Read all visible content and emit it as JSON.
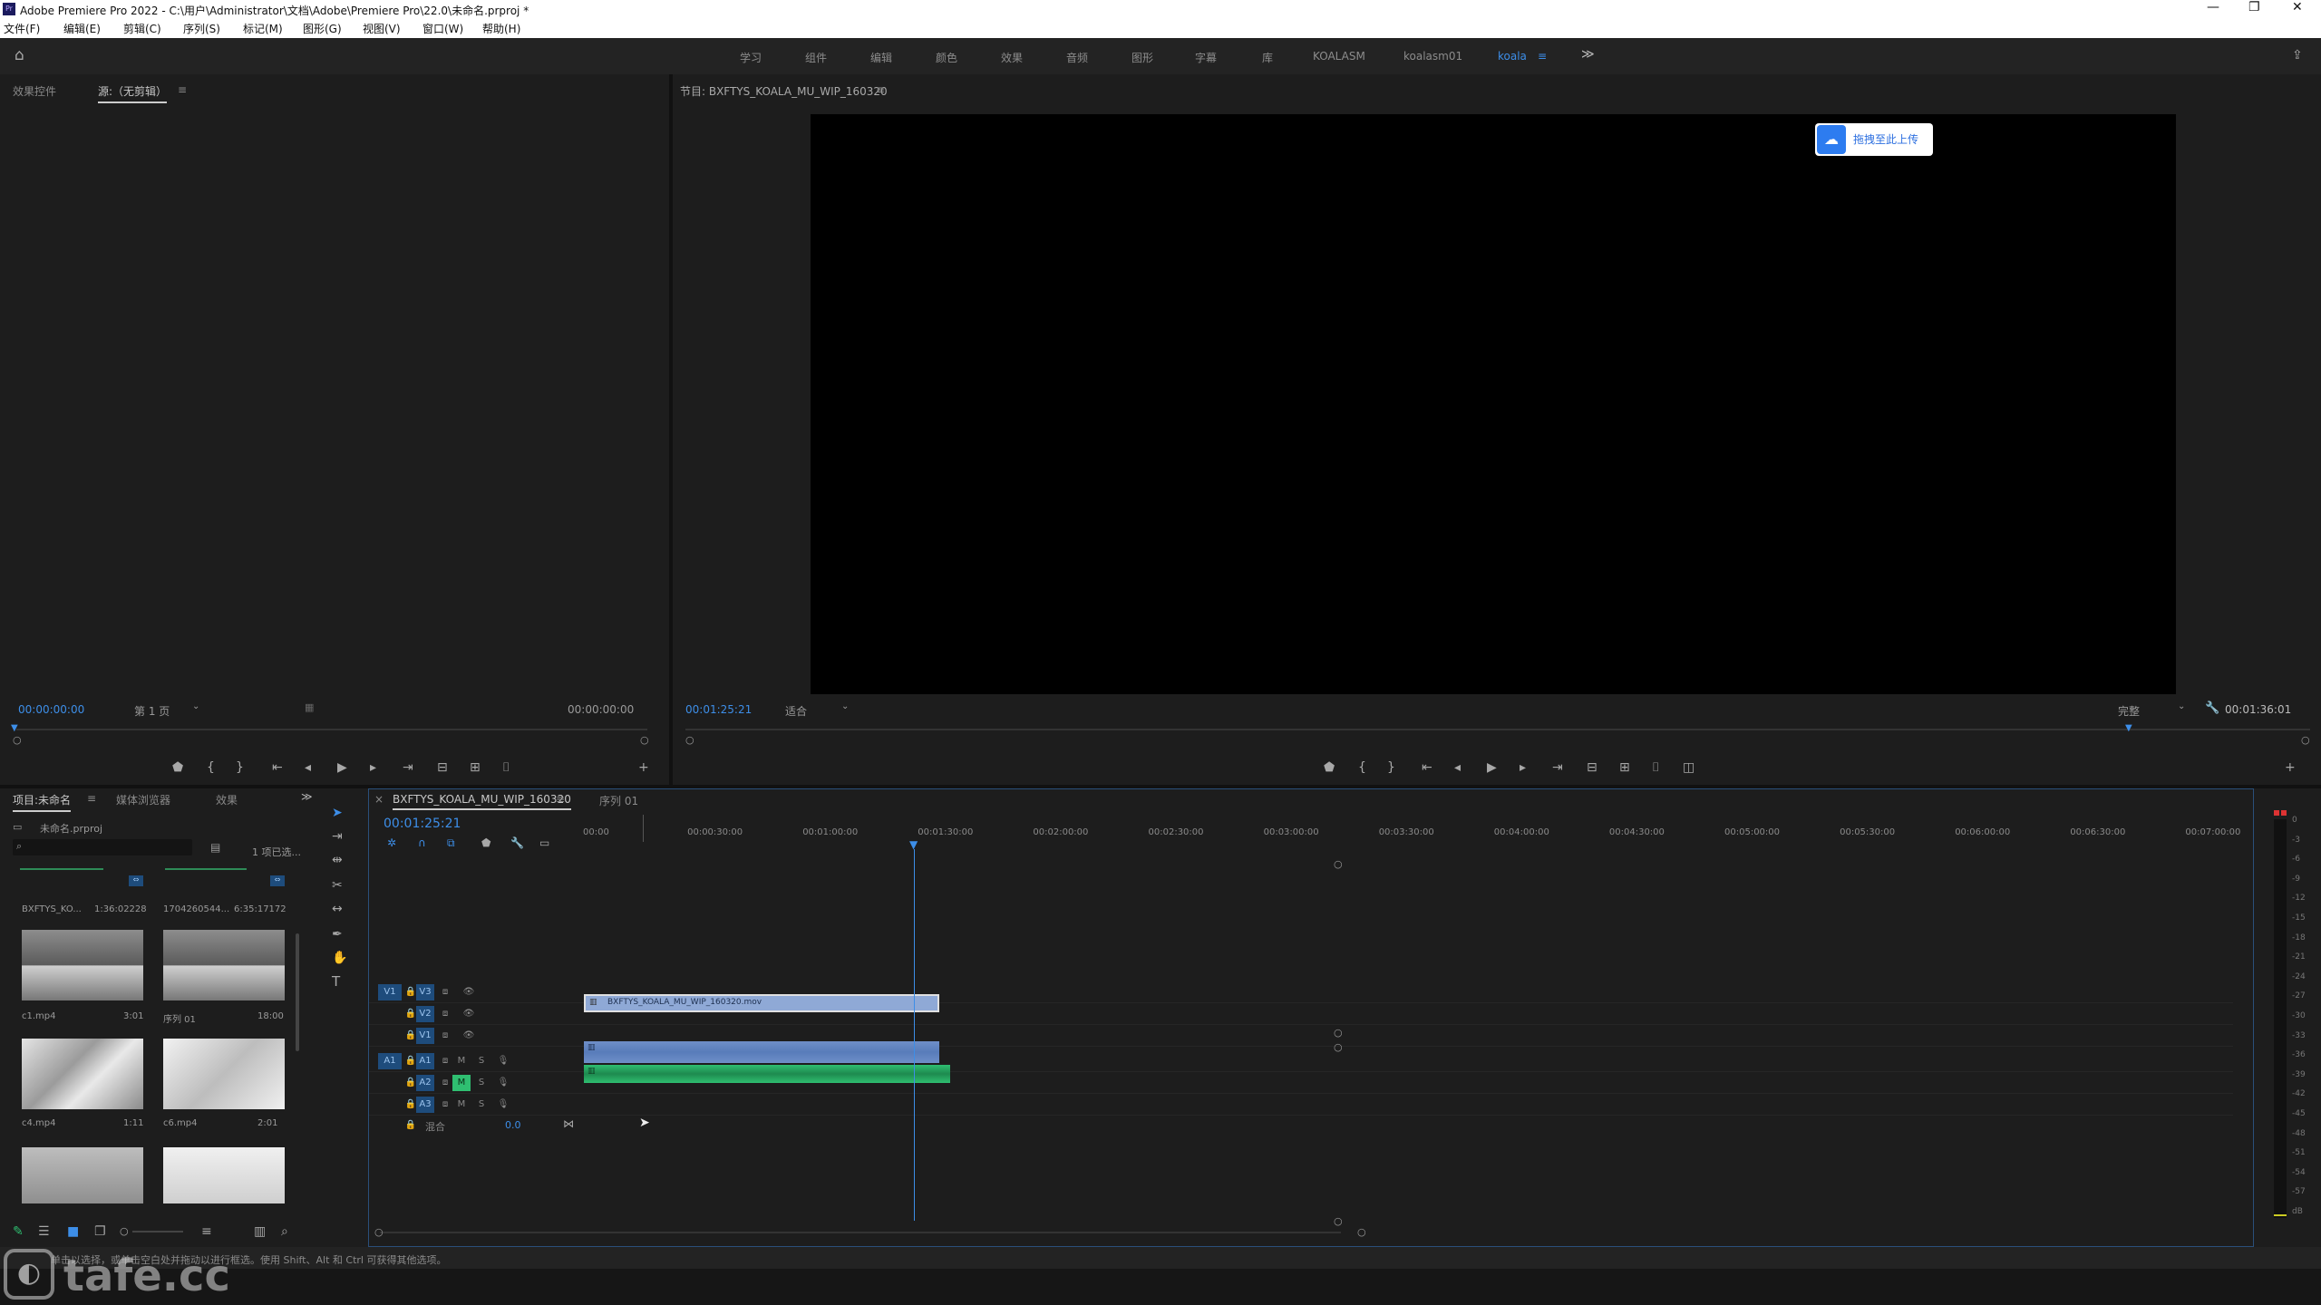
{
  "window": {
    "title": "Adobe Premiere Pro 2022 - C:\\用户\\Administrator\\文档\\Adobe\\Premiere Pro\\22.0\\未命名.prproj *"
  },
  "menu": [
    "文件(F)",
    "编辑(E)",
    "剪辑(C)",
    "序列(S)",
    "标记(M)",
    "图形(G)",
    "视图(V)",
    "窗口(W)",
    "帮助(H)"
  ],
  "workspaces": {
    "items": [
      "学习",
      "组件",
      "编辑",
      "颜色",
      "效果",
      "音频",
      "图形",
      "字幕",
      "库",
      "KOALASM",
      "koalasm01",
      "koala"
    ],
    "active": "koala",
    "more": "≫"
  },
  "source_monitor": {
    "tabs": [
      "效果控件",
      "源:（无剪辑）"
    ],
    "timecode_in": "00:00:00:00",
    "page": "第 1 页",
    "timecode_out": "00:00:00:00"
  },
  "program_monitor": {
    "title": "节目: BXFTYS_KOALA_MU_WIP_160320",
    "timecode": "00:01:25:21",
    "fit": "适合",
    "quality": "完整",
    "duration": "00:01:36:01",
    "upload_badge": "拖拽至此上传"
  },
  "project_panel": {
    "tabs": [
      "项目:未命名",
      "媒体浏览器",
      "效果"
    ],
    "file": "未命名.prproj",
    "selected": "1 项已选...",
    "items_top": [
      {
        "name": "BXFTYS_KO...",
        "duration": "1:36:02228"
      },
      {
        "name": "1704260544...",
        "duration": "6:35:17172"
      }
    ],
    "items": [
      {
        "name": "c1.mp4",
        "duration": "3:01"
      },
      {
        "name": "序列 01",
        "duration": "18:00"
      },
      {
        "name": "c4.mp4",
        "duration": "1:11"
      },
      {
        "name": "c6.mp4",
        "duration": "2:01"
      }
    ]
  },
  "timeline": {
    "tabs": [
      "BXFTYS_KOALA_MU_WIP_160320",
      "序列 01"
    ],
    "timecode": "00:01:25:21",
    "ruler": [
      "00:00",
      "00:00:30:00",
      "00:01:00:00",
      "00:01:30:00",
      "00:02:00:00",
      "00:02:30:00",
      "00:03:00:00",
      "00:03:30:00",
      "00:04:00:00",
      "00:04:30:00",
      "00:05:00:00",
      "00:05:30:00",
      "00:06:00:00",
      "00:06:30:00",
      "00:07:00:00"
    ],
    "video_tracks": [
      "V3",
      "V2",
      "V1"
    ],
    "audio_tracks": [
      "A1",
      "A2",
      "A3"
    ],
    "src_video": "V1",
    "src_audio": "A1",
    "mix_label": "混合",
    "mix_value": "0.0",
    "clip_name": "BXFTYS_KOALA_MU_WIP_160320.mov",
    "track_btn_m": "M",
    "track_btn_s": "S"
  },
  "audio_meter": {
    "ticks": [
      "0",
      "-3",
      "-6",
      "-9",
      "-12",
      "-15",
      "-18",
      "-21",
      "-24",
      "-27",
      "-30",
      "-33",
      "-36",
      "-39",
      "-42",
      "-45",
      "-48",
      "-51",
      "-54",
      "-57",
      "dB"
    ]
  },
  "status_bar": {
    "text": "单击以选择，或单击空白处并拖动以进行框选。使用 Shift、Alt 和 Ctrl 可获得其他选项。",
    "watermark": "tafe.cc"
  },
  "colors": {
    "accent": "#3d8ee8",
    "video_clip": "#8fa9d6",
    "audio_clip_a1": "#6f8fc8",
    "audio_clip_a2": "#2fbf71"
  }
}
